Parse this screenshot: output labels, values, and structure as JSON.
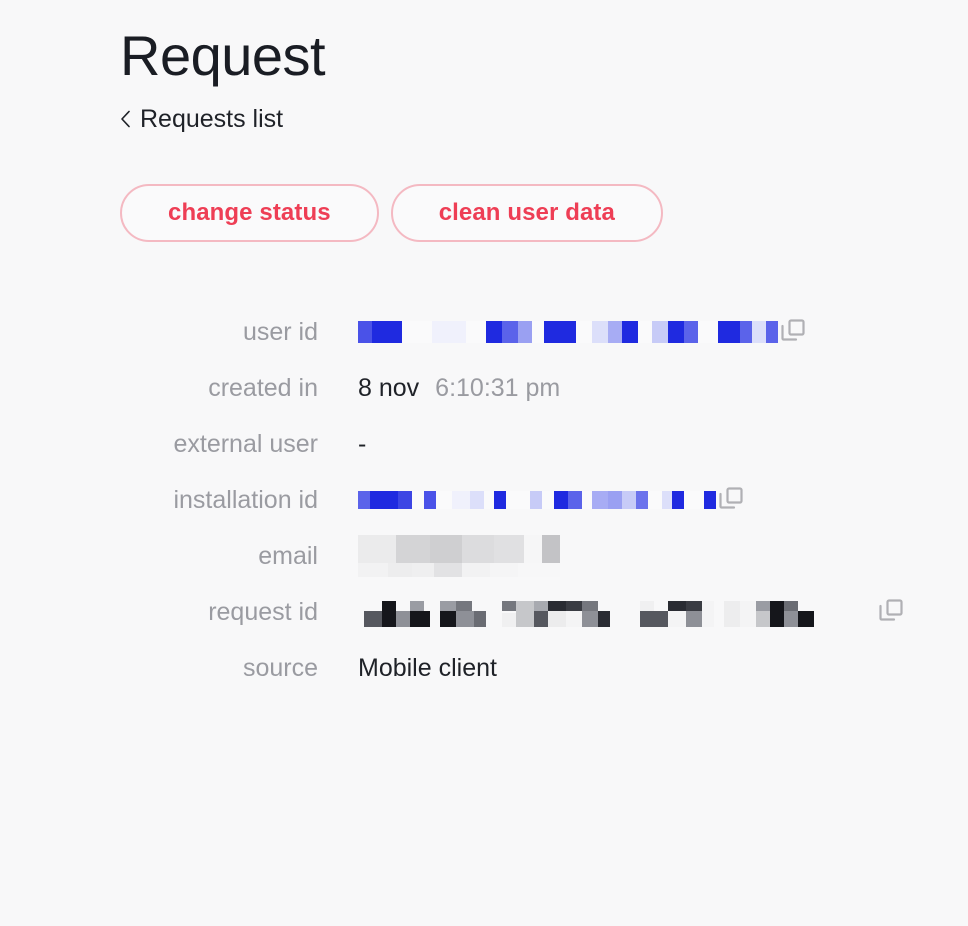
{
  "header": {
    "title": "Request",
    "breadcrumb": {
      "icon": "chevron-left-icon",
      "label": "Requests list"
    }
  },
  "colors": {
    "page_background": "#f8f8f9",
    "title_text": "#1a1d24",
    "label_text": "#9a9ba1",
    "value_text": "#1f2228",
    "accent_red": "#ee3e55",
    "button_border": "#f4b9c2",
    "redaction_blue": "#1f2ae0",
    "redaction_dark": "#15161b",
    "icon_gray": "#b0b0b4"
  },
  "actions": {
    "buttons": [
      {
        "label": "change status",
        "name": "change-status-button"
      },
      {
        "label": "clean user data",
        "name": "clean-user-data-button"
      }
    ]
  },
  "details": {
    "rows": [
      {
        "label": "user id",
        "name": "user-id",
        "value_type": "redacted-blue",
        "value_text": "",
        "copy_icon": true,
        "copy_icon_label": "copy-icon"
      },
      {
        "label": "created in",
        "name": "created-in",
        "value_type": "text",
        "value_text": "8 nov",
        "value_secondary": "6:10:31 pm",
        "copy_icon": false
      },
      {
        "label": "external user",
        "name": "external-user",
        "value_type": "text",
        "value_text": "-",
        "copy_icon": false
      },
      {
        "label": "installation id",
        "name": "installation-id",
        "value_type": "redacted-blue",
        "value_text": "",
        "copy_icon": true,
        "copy_icon_label": "copy-icon"
      },
      {
        "label": "email",
        "name": "email",
        "value_type": "redacted-gray",
        "value_text": "",
        "copy_icon": false
      },
      {
        "label": "request id",
        "name": "request-id",
        "value_type": "redacted-dark",
        "value_text": "",
        "copy_icon": true,
        "copy_icon_label": "copy-icon"
      },
      {
        "label": "source",
        "name": "source",
        "value_type": "text",
        "value_text": "Mobile client",
        "copy_icon": false
      }
    ]
  }
}
